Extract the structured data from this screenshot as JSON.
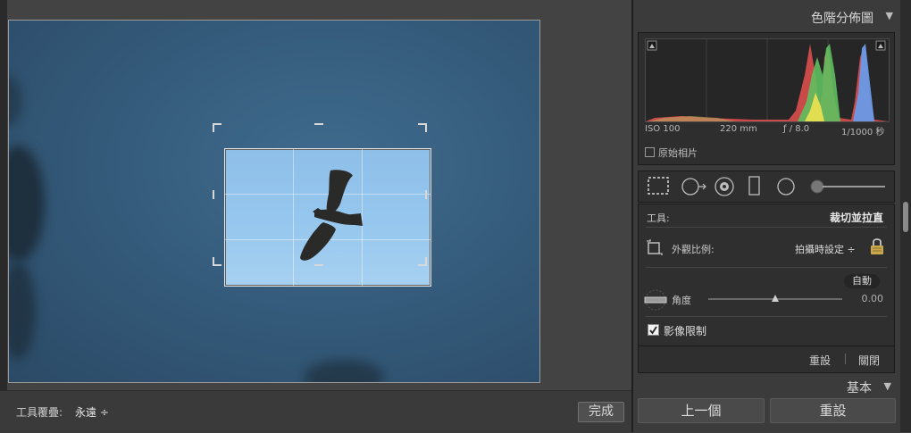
{
  "toolbar": {
    "overlay_label": "工具覆疊:",
    "overlay_value": "永遠 ÷",
    "done_label": "完成"
  },
  "histogram": {
    "title": "色階分佈圖",
    "iso": "ISO 100",
    "focal": "220 mm",
    "aperture": "ƒ / 8.0",
    "shutter": "1/1000 秒",
    "original_photo_label": "原始相片"
  },
  "crop_panel": {
    "tool_label": "工具:",
    "tool_name": "裁切並拉直",
    "aspect_label": "外觀比例:",
    "aspect_value": "拍攝時設定 ÷",
    "auto_label": "自動",
    "angle_label": "角度",
    "angle_value": "0.00",
    "constrain_label": "影像限制",
    "constrain_checked": true,
    "reset_label": "重設",
    "close_label": "關閉"
  },
  "basic_panel": {
    "title": "基本"
  },
  "footer": {
    "prev_label": "上一個",
    "reset_label": "重設"
  },
  "colors": {
    "panel_bg": "#2f2f2f",
    "photo_sky": "#355c7c",
    "crop_sky": "#95c6ee"
  }
}
